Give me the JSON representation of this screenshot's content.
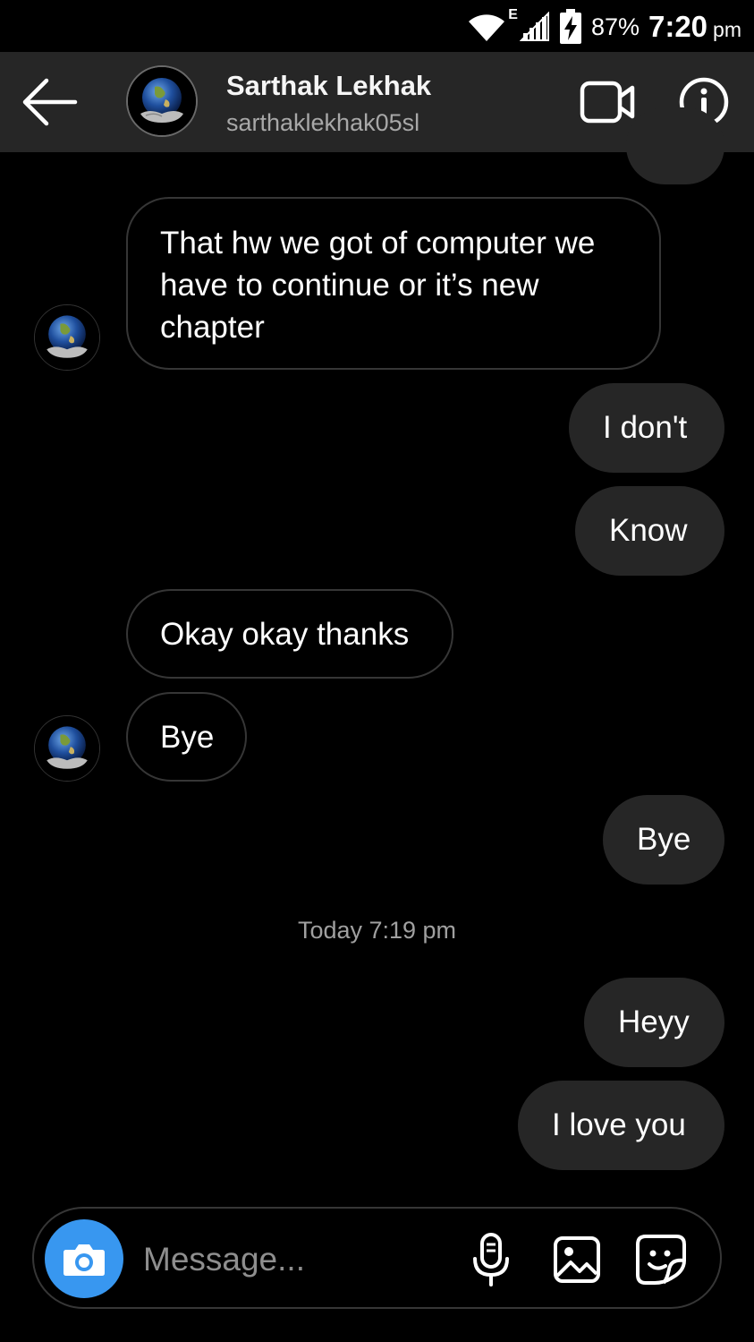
{
  "status_bar": {
    "network_type": "E",
    "battery_percent": "87%",
    "time": "7:20",
    "ampm": "pm"
  },
  "header": {
    "contact_name": "Sarthak Lekhak",
    "contact_username": "sarthaklekhak05sl"
  },
  "messages": [
    {
      "from": "them",
      "text": "That hw we got of computer we have to continue or it’s new chapter"
    },
    {
      "from": "me",
      "text": "I don't"
    },
    {
      "from": "me",
      "text": "Know"
    },
    {
      "from": "them",
      "text": "Okay okay thanks"
    },
    {
      "from": "them",
      "text": "Bye"
    },
    {
      "from": "me",
      "text": "Bye"
    },
    {
      "from": "me",
      "text": "Heyy"
    },
    {
      "from": "me",
      "text": "I love you"
    }
  ],
  "timestamp_divider": "Today 7:19 pm",
  "composer": {
    "placeholder": "Message..."
  },
  "colors": {
    "background": "#000000",
    "header_bg": "#262626",
    "outgoing_bubble": "#262626",
    "incoming_border": "#363636",
    "accent_blue": "#3897f0"
  },
  "icons": {
    "back": "arrow-left-icon",
    "video": "video-call-icon",
    "info": "info-icon",
    "camera": "camera-icon",
    "mic": "microphone-icon",
    "gallery": "gallery-icon",
    "sticker": "sticker-icon"
  }
}
